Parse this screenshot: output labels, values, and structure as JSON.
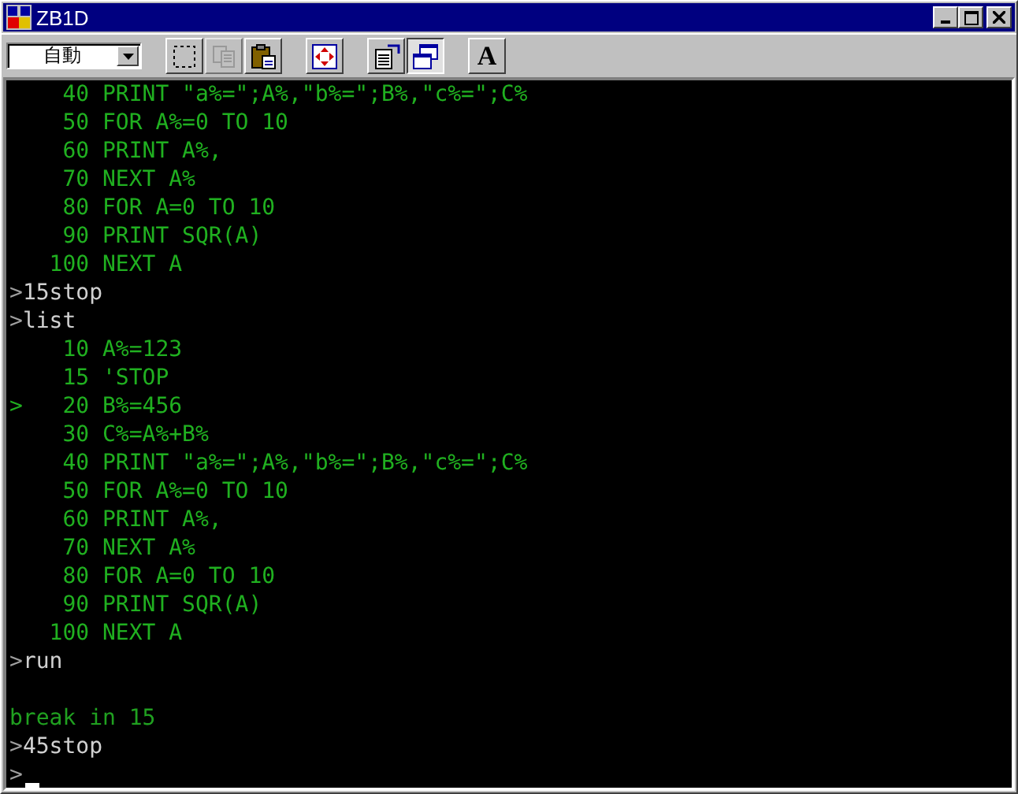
{
  "window": {
    "title": "ZB1D"
  },
  "toolbar": {
    "mode_select": {
      "value": "自動"
    },
    "buttons": [
      {
        "kind": "select",
        "pressed": false,
        "disabled": false
      },
      {
        "kind": "copy",
        "pressed": false,
        "disabled": true
      },
      {
        "kind": "paste",
        "pressed": false,
        "disabled": false
      },
      {
        "kind": "move",
        "pressed": false,
        "disabled": false
      },
      {
        "kind": "properties",
        "pressed": false,
        "disabled": false
      },
      {
        "kind": "window",
        "pressed": true,
        "disabled": false
      },
      {
        "kind": "font",
        "pressed": false,
        "disabled": false,
        "label": "A"
      }
    ]
  },
  "console": {
    "lines": [
      {
        "kind": "listing",
        "number": "40",
        "code": "PRINT \"a%=\";A%,\"b%=\";B%,\"c%=\";C%"
      },
      {
        "kind": "listing",
        "number": "50",
        "code": "FOR A%=0 TO 10"
      },
      {
        "kind": "listing",
        "number": "60",
        "code": "PRINT A%,"
      },
      {
        "kind": "listing",
        "number": "70",
        "code": "NEXT A%"
      },
      {
        "kind": "listing",
        "number": "80",
        "code": "FOR A=0 TO 10"
      },
      {
        "kind": "listing",
        "number": "90",
        "code": "PRINT SQR(A)"
      },
      {
        "kind": "listing",
        "number": "100",
        "code": "NEXT A"
      },
      {
        "kind": "input",
        "prompt": ">",
        "text": "15stop"
      },
      {
        "kind": "input",
        "prompt": ">",
        "text": "list"
      },
      {
        "kind": "listing",
        "number": "10",
        "code": "A%=123"
      },
      {
        "kind": "listing",
        "number": "15",
        "code": "'STOP"
      },
      {
        "kind": "listing",
        "marker": ">",
        "number": "20",
        "code": "B%=456"
      },
      {
        "kind": "listing",
        "number": "30",
        "code": "C%=A%+B%"
      },
      {
        "kind": "listing",
        "number": "40",
        "code": "PRINT \"a%=\";A%,\"b%=\";B%,\"c%=\";C%"
      },
      {
        "kind": "listing",
        "number": "50",
        "code": "FOR A%=0 TO 10"
      },
      {
        "kind": "listing",
        "number": "60",
        "code": "PRINT A%,"
      },
      {
        "kind": "listing",
        "number": "70",
        "code": "NEXT A%"
      },
      {
        "kind": "listing",
        "number": "80",
        "code": "FOR A=0 TO 10"
      },
      {
        "kind": "listing",
        "number": "90",
        "code": "PRINT SQR(A)"
      },
      {
        "kind": "listing",
        "number": "100",
        "code": "NEXT A"
      },
      {
        "kind": "input",
        "prompt": ">",
        "text": "run"
      },
      {
        "kind": "blank"
      },
      {
        "kind": "output",
        "text": "break in 15"
      },
      {
        "kind": "input",
        "prompt": ">",
        "text": "45stop"
      },
      {
        "kind": "input",
        "prompt": ">",
        "cursor": true
      }
    ]
  }
}
